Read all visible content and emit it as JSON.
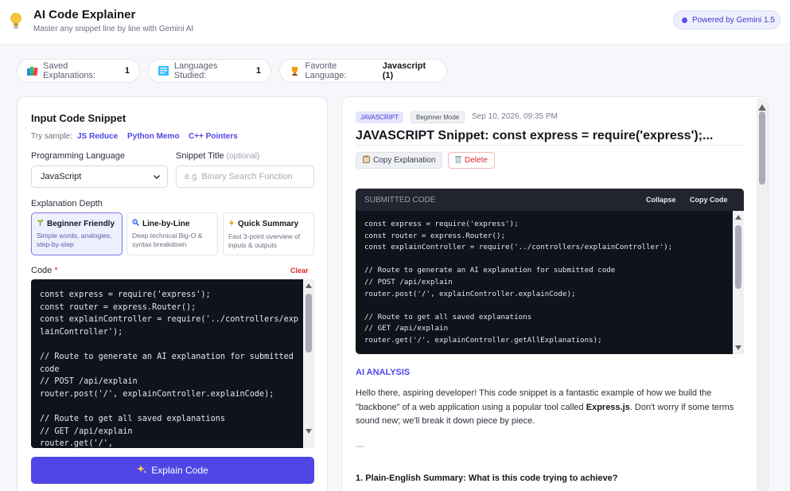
{
  "header": {
    "title": "AI Code Explainer",
    "subtitle": "Master any snippet line by line with Gemini AI",
    "powered_by": "Powered by Gemini 1.5"
  },
  "stats": [
    {
      "label": "Saved Explanations:",
      "value": "1",
      "icon": "books-icon"
    },
    {
      "label": "Languages Studied:",
      "value": "1",
      "icon": "notebook-icon"
    },
    {
      "label": "Favorite Language:",
      "value": "Javascript (1)",
      "icon": "trophy-icon"
    }
  ],
  "input_panel": {
    "title": "Input Code Snippet",
    "try_sample_label": "Try sample:",
    "samples": [
      "JS Reduce",
      "Python Memo",
      "C++ Pointers"
    ],
    "language_label": "Programming Language",
    "language_value": "JavaScript",
    "snippet_title_label": "Snippet Title",
    "snippet_title_optional": "(optional)",
    "snippet_title_placeholder": "e.g. Binary Search Function",
    "depth_label": "Explanation Depth",
    "depths": [
      {
        "title": "Beginner Friendly",
        "desc": "Simple words, analogies, step-by-step",
        "icon": "seedling-icon",
        "active": true
      },
      {
        "title": "Line-by-Line",
        "desc": "Deep technical Big-O & syntax breakdown",
        "icon": "magnifier-icon",
        "active": false
      },
      {
        "title": "Quick Summary",
        "desc": "Fast 3-point overview of inputs & outputs",
        "icon": "lightning-icon",
        "active": false
      }
    ],
    "code_label": "Code",
    "required_mark": "*",
    "clear_label": "Clear",
    "code": "const express = require('express');\nconst router = express.Router();\nconst explainController = require('../controllers/explainController');\n\n// Route to generate an AI explanation for submitted code\n// POST /api/explain\nrouter.post('/', explainController.explainCode);\n\n// Route to get all saved explanations\n// GET /api/explain\nrouter.get('/',",
    "explain_button": "Explain Code"
  },
  "result_panel": {
    "language_tag": "JAVASCRIPT",
    "mode_tag": "Beginner Mode",
    "timestamp": "Sep 10, 2026, 09:35 PM",
    "title": "JAVASCRIPT Snippet: const express = require('express');...",
    "copy_label": "Copy Explanation",
    "delete_label": "Delete",
    "submitted_code_label": "SUBMITTED CODE",
    "collapse_label": "Collapse",
    "copy_code_label": "Copy Code",
    "submitted_code": "const express = require('express');\nconst router = express.Router();\nconst explainController = require('../controllers/explainController');\n\n// Route to generate an AI explanation for submitted code\n// POST /api/explain\nrouter.post('/', explainController.explainCode);\n\n// Route to get all saved explanations\n// GET /api/explain\nrouter.get('/', explainController.getAllExplanations);",
    "analysis_label": "AI ANALYSIS",
    "analysis_intro_1": "Hello there, aspiring developer! This code snippet is a fantastic example of how we build the \"backbone\" of a web application using a popular tool called ",
    "analysis_intro_bold": "Express.js",
    "analysis_intro_2": ". Don't worry if some terms sound new; we'll break it down piece by piece.",
    "separator": "---",
    "section_1": "1. Plain-English Summary: What is this code trying to achieve?"
  },
  "colors": {
    "accent": "#4f46e5",
    "danger": "#dc2626",
    "code_bg": "#11131c"
  }
}
